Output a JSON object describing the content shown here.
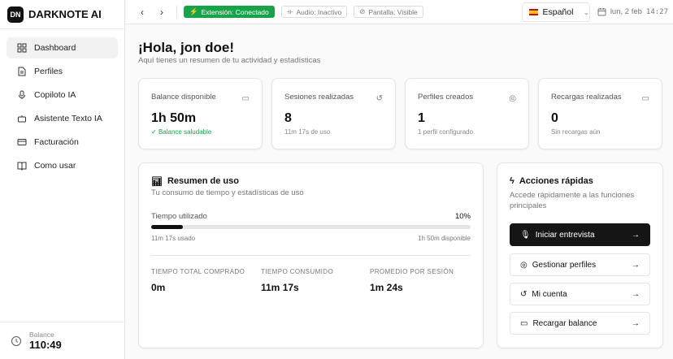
{
  "app": {
    "logo_mark": "DN",
    "name": "DARKNOTE AI"
  },
  "sidebar": {
    "items": [
      {
        "label": "Dashboard",
        "icon": "dashboard-icon",
        "active": true
      },
      {
        "label": "Perfiles",
        "icon": "file-icon"
      },
      {
        "label": "Copiloto IA",
        "icon": "mic-icon"
      },
      {
        "label": "Asistente Texto IA",
        "icon": "bot-icon"
      },
      {
        "label": "Facturación",
        "icon": "card-icon"
      },
      {
        "label": "Como usar",
        "icon": "book-icon"
      }
    ],
    "balance_label": "Balance",
    "balance_value": "110:49"
  },
  "header": {
    "extension": "Extensión: Conectado",
    "audio": "Audio: Inactivo",
    "screen": "Pantalla: Visible",
    "language": "Español",
    "date": "lun, 2 feb",
    "time": "14:27",
    "accent": "#16a34a"
  },
  "main": {
    "greeting": "¡Hola, jon doe!",
    "subtitle": "Aquí tienes un resumen de tu actividad y estadísticas",
    "stats": [
      {
        "title": "Balance disponible",
        "value": "1h 50m",
        "sub": "Balance saludable",
        "icon": "wallet-icon"
      },
      {
        "title": "Sesiones realizadas",
        "value": "8",
        "sub": "11m 17s de uso",
        "icon": "history-icon"
      },
      {
        "title": "Perfiles creados",
        "value": "1",
        "sub": "1 perfil configurado",
        "icon": "target-icon"
      },
      {
        "title": "Recargas realizadas",
        "value": "0",
        "sub": "Sin recargas aún",
        "icon": "card-icon"
      }
    ],
    "usage": {
      "title": "Resumen de uso",
      "desc": "Tu consumo de tiempo y estadísticas de uso",
      "bar_label": "Tiempo utilizado",
      "percent_label": "10%",
      "percent": 10,
      "used": "11m 17s usado",
      "available": "1h 50m disponible",
      "metrics": [
        {
          "k": "TIEMPO TOTAL COMPRADO",
          "v": "0m"
        },
        {
          "k": "TIEMPO CONSUMIDO",
          "v": "11m 17s"
        },
        {
          "k": "PROMEDIO POR SESIÓN",
          "v": "1m 24s"
        }
      ]
    },
    "actions": {
      "title": "Acciones rápidas",
      "desc": "Accede rápidamente a las funciones principales",
      "buttons": [
        {
          "label": "Iniciar entrevista",
          "icon": "mic-icon"
        },
        {
          "label": "Gestionar perfiles",
          "icon": "target-icon"
        },
        {
          "label": "Mi cuenta",
          "icon": "history-icon"
        },
        {
          "label": "Recargar balance",
          "icon": "card-icon"
        }
      ]
    }
  }
}
